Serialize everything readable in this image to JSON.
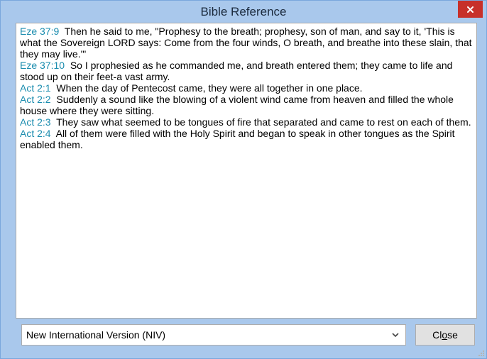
{
  "window": {
    "title": "Bible Reference",
    "close_icon": "close-x-icon"
  },
  "passages": [
    {
      "ref": "Eze 37:9",
      "text": "Then he said to me, \"Prophesy to the breath; prophesy, son of man, and say to it, 'This is what the Sovereign LORD says: Come from the four winds, O breath, and breathe into these slain, that they may live.'\""
    },
    {
      "ref": "Eze 37:10",
      "text": "So I prophesied as he commanded me, and breath entered them; they came to life and stood up on their feet-a vast army."
    },
    {
      "ref": "Act 2:1",
      "text": "When the day of Pentecost came, they were all together in one place."
    },
    {
      "ref": "Act 2:2",
      "text": "Suddenly a sound like the blowing of a violent wind came from heaven and filled the whole house where they were sitting."
    },
    {
      "ref": "Act 2:3",
      "text": "They saw what seemed to be tongues of fire that separated and came to rest on each of them."
    },
    {
      "ref": "Act 2:4",
      "text": "All of them were filled with the Holy Spirit and began to speak in other tongues as the Spirit enabled them."
    }
  ],
  "version_select": {
    "selected": "New International Version (NIV)"
  },
  "close_button": {
    "label_pre": "Cl",
    "label_accel": "o",
    "label_post": "se"
  },
  "colors": {
    "reference": "#1a8cae",
    "titlebar": "#a9c8ec",
    "close_red": "#c7302a"
  }
}
